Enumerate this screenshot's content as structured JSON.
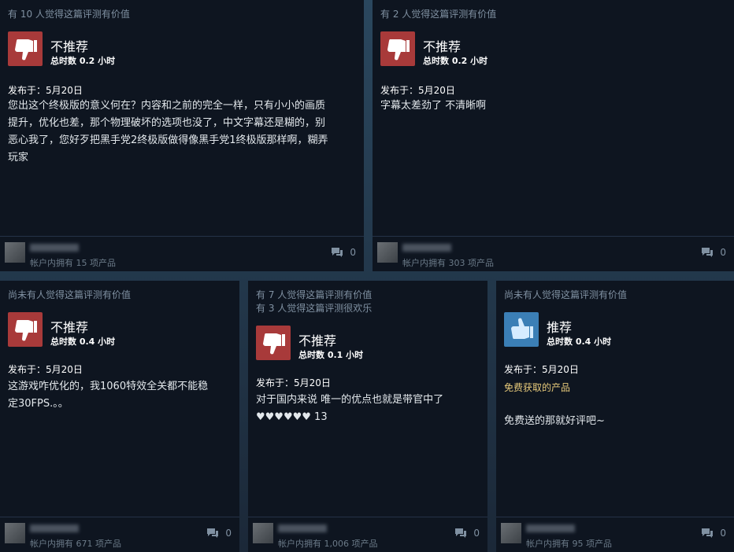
{
  "reviews": [
    {
      "helpful_lines": [
        "有 10 人觉得这篇评测有价值"
      ],
      "recommend": "negative",
      "verdict": "不推荐",
      "hours": "总时数 0.2 小时",
      "posted": "发布于：5月20日",
      "note": "",
      "body": "您出这个终极版的意义何在？内容和之前的完全一样，只有小小的画质\n提升，优化也差，那个物理破坏的选项也没了，中文字幕还是糊的，别\n恶心我了，您好歹把黑手党2终极版做得像黑手党1终极版那样啊，糊弄\n玩家",
      "owned": "帐户内拥有 15 项产品",
      "comments": "0"
    },
    {
      "helpful_lines": [
        "有 2 人觉得这篇评测有价值"
      ],
      "recommend": "negative",
      "verdict": "不推荐",
      "hours": "总时数 0.2 小时",
      "posted": "发布于：5月20日",
      "note": "",
      "body": "字幕太差劲了 不清晰啊",
      "owned": "帐户内拥有 303 项产品",
      "comments": "0"
    },
    {
      "helpful_lines": [
        "尚未有人觉得这篇评测有价值"
      ],
      "recommend": "negative",
      "verdict": "不推荐",
      "hours": "总时数 0.4 小时",
      "posted": "发布于：5月20日",
      "note": "",
      "body": "这游戏咋优化的，我1060特效全关都不能稳\n定30FPS.。。",
      "owned": "帐户内拥有 671 项产品",
      "comments": "0"
    },
    {
      "helpful_lines": [
        "有 7 人觉得这篇评测有价值",
        "有 3 人觉得这篇评测很欢乐"
      ],
      "recommend": "negative",
      "verdict": "不推荐",
      "hours": "总时数 0.1 小时",
      "posted": "发布于：5月20日",
      "note": "",
      "body": "对于国内来说 唯一的优点也就是带官中了\n♥♥♥♥♥♥ 13",
      "owned": "帐户内拥有 1,006 项产品",
      "comments": "0"
    },
    {
      "helpful_lines": [
        "尚未有人觉得这篇评测有价值"
      ],
      "recommend": "positive",
      "verdict": "推荐",
      "hours": "总时数 0.4 小时",
      "posted": "发布于：5月20日",
      "note": "免费获取的产品",
      "body": "免费送的那就好评吧~",
      "owned": "帐户内拥有 95 项产品",
      "comments": "0"
    }
  ],
  "icons": {
    "thumbs_down": "thumbs-down-icon",
    "thumbs_up": "thumbs-up-icon",
    "comment": "comment-icon"
  },
  "colors": {
    "negative": "#a83a3a",
    "positive": "#3b7fb6",
    "free_note": "#e6c97a"
  }
}
